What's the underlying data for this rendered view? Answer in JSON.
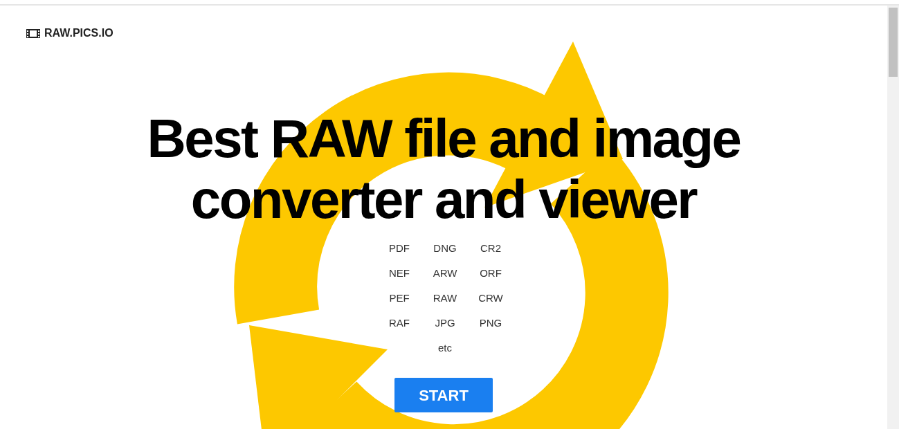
{
  "logo": {
    "text": "RAW.PICS.IO"
  },
  "hero": {
    "title_lines": [
      "Best RAW file and image",
      "converter and viewer"
    ],
    "formats": [
      "PDF",
      "DNG",
      "CR2",
      "NEF",
      "ARW",
      "ORF",
      "PEF",
      "RAW",
      "CRW",
      "RAF",
      "JPG",
      "PNG",
      "etc"
    ],
    "button": "START"
  }
}
